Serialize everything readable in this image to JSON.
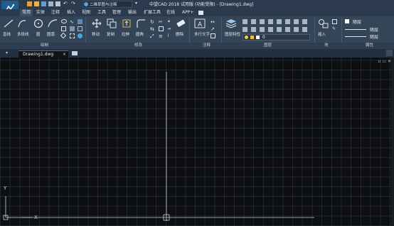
{
  "titlebar": {
    "workspace": "二维草图与注释",
    "title": "中望CAD 2018 试用版 (功能受限) - [Drawing1.dwg]"
  },
  "tabs": [
    "常用",
    "实体",
    "注释",
    "插入",
    "视图",
    "工具",
    "管理",
    "输出",
    "扩展工具",
    "在线",
    "APP+"
  ],
  "ribbon": {
    "draw": {
      "line": "直线",
      "polyline": "多段线",
      "circle": "圆",
      "arc": "圆弧"
    },
    "modify": {
      "move": "移动",
      "copy": "复制",
      "stretch": "拉伸",
      "fillet": "圆角",
      "erase": "删除"
    },
    "annotation": {
      "mtext": "多行文字"
    },
    "layers": {
      "layer_props": "图层特性",
      "current": "0"
    },
    "block": {
      "insert": "插入"
    },
    "props": {
      "bylayer1": "随层",
      "bylayer2": "随层",
      "bylayer3": "随层"
    },
    "panels": {
      "draw": "绘制",
      "modify": "修改",
      "annotation": "注释",
      "layers": "图层",
      "block": "块",
      "properties": "属性"
    }
  },
  "filetab": {
    "name": "Drawing1.dwg"
  },
  "canvas": {
    "x_label": "X",
    "y_label": "Y"
  },
  "colors": {
    "accent": "#1d5d91",
    "ribbon": "#344558",
    "canvas": "#0d0f12"
  }
}
